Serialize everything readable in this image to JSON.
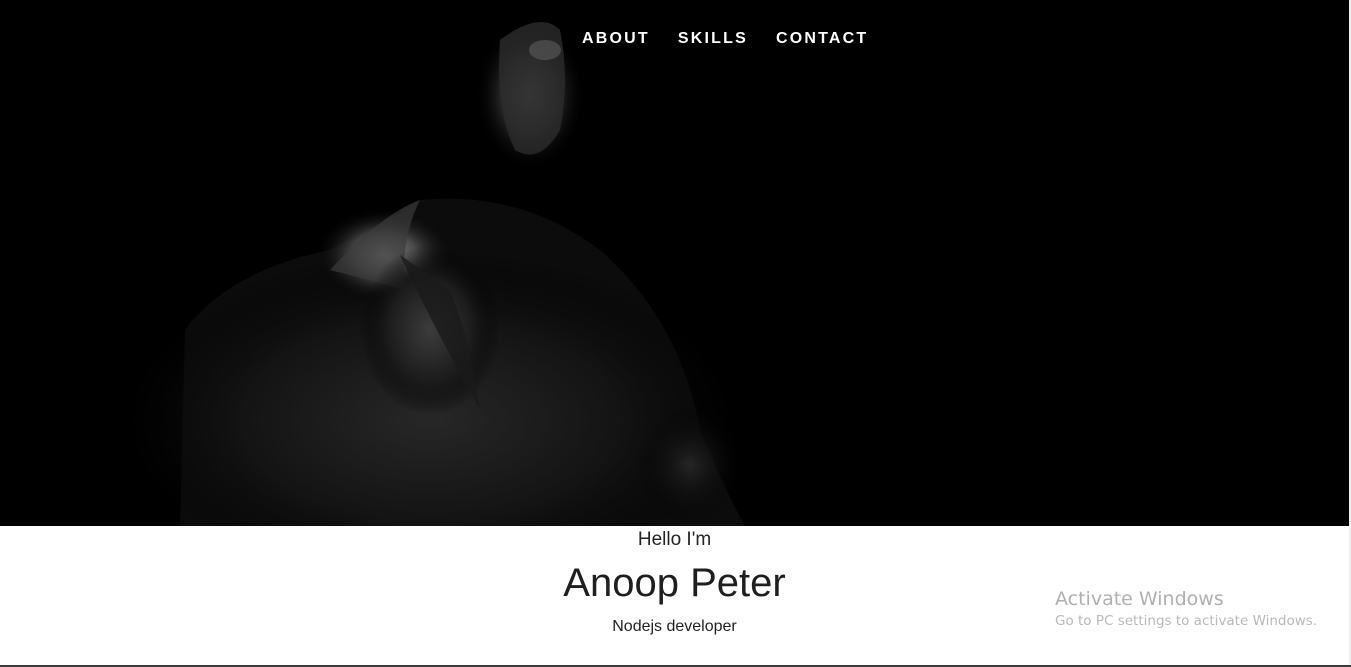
{
  "nav": {
    "items": [
      {
        "label": "ABOUT"
      },
      {
        "label": "SKILLS"
      },
      {
        "label": "CONTACT"
      }
    ]
  },
  "hero": {
    "image": "portrait-dark-man-photo",
    "background_color": "#000000"
  },
  "intro": {
    "greeting": "Hello I'm",
    "name": "Anoop Peter",
    "role": "Nodejs developer"
  },
  "watermark": {
    "title": "Activate Windows",
    "subtitle": "Go to PC settings to activate Windows."
  }
}
